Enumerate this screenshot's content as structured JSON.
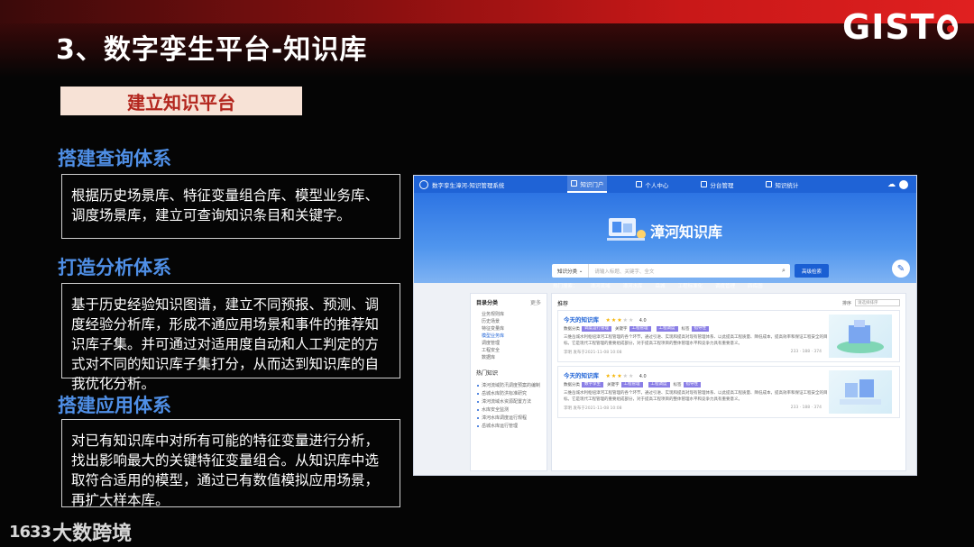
{
  "slide": {
    "title": "3、数字孪生平台-知识库",
    "logo": "GISTC",
    "banner": "建立知识平台",
    "watermark_num": "1633",
    "watermark_text": "大数跨境"
  },
  "sections": [
    {
      "heading": "搭建查询体系",
      "body": "根据历史场景库、特征变量组合库、模型业务库、调度场景库，建立可查询知识条目和关键字。"
    },
    {
      "heading": "打造分析体系",
      "body": "基于历史经验知识图谱，建立不同预报、预测、调度经验分析库，形成不通应用场景和事件的推荐知识库子集。并可通过对适用度自动和人工判定的方式对不同的知识库子集打分，从而达到知识库的自我优化分析。"
    },
    {
      "heading": "搭建应用体系",
      "body": "对已有知识库中对所有可能的特征变量进行分析，找出影响最大的关键特征变量组合。从知识库中选取符合适用的模型，通过已有数值模拟应用场景，再扩大样本库。"
    }
  ],
  "app": {
    "name": "数字孪生漳河-知识管理系统",
    "nav": [
      "知识门户",
      "个人中心",
      "分台管理",
      "知识统计"
    ],
    "weather_icon": "cloud-sun-icon",
    "hero_title": "漳河知识库",
    "search_category": "知识分类",
    "search_placeholder": "请输入标题、关键字、全文",
    "advanced_search": "高级检索",
    "hot_label": "热门搜索：",
    "hot_terms": [
      "漳河流域",
      "漳河水库",
      "岳城",
      "工程标准化",
      "调度管理",
      "四库图"
    ],
    "side": {
      "title": "目录分类",
      "more": "更多",
      "items": [
        "业务规则库",
        "历史场景",
        "特征变量库",
        "模型业务库",
        "调度管理",
        "工程安全",
        "数据库"
      ],
      "active_index": 3,
      "hot_title": "热门知识",
      "hot_items": [
        "漳河流域防汛调度预案的编制",
        "岳城水库防洪标准研究",
        "漳河流域水资源配置方法",
        "水库安全监测",
        "漳河水库调度运行规程",
        "岳城水库运行管理"
      ]
    },
    "main": {
      "title": "推荐",
      "sort_label": "排序",
      "sort_value": "请选择排序",
      "cards": [
        {
          "title": "今天的知识库",
          "rating": 3,
          "score": "4.0",
          "type_label": "数据分类",
          "tag1": "调度运行管理",
          "keyword_label": "关键字",
          "tag2": "工程管理",
          "tag3": "工程调度",
          "tag_label": "标签",
          "tag4": "指导性",
          "desc": "三维岳城水利枢纽漳河工程管理的各个环节，通过引进、实现和提高对现有管理体系、以此提高工程质量、降低成本，提高效率和保证工程安全的目标。它是现代工程管理的重要组成部分，对于提高工程项目的整体管理水平和竞争力具有重要意义。",
          "author": "李明 发布于2021-11-08 10:08",
          "stats": "233 · 188 · 374"
        },
        {
          "title": "今天的知识库",
          "rating": 3,
          "score": "4.0",
          "type_label": "数据分类",
          "tag1": "数字孪生",
          "keyword_label": "关键字",
          "tag2": "工程管理",
          "tag3": "工程调度",
          "tag_label": "标签",
          "tag4": "指导性",
          "desc": "三维岳城水利枢纽漳河工程管理的各个环节，通过引进、实现和提高对现有管理体系、以此提高工程质量、降低成本，提高效率和保证工程安全的目标。它是现代工程管理的重要组成部分，对于提高工程项目的整体管理水平和竞争力具有重要意义。",
          "author": "李明 发布于2021-11-08 10:08",
          "stats": "233 · 188 · 374"
        }
      ]
    }
  }
}
